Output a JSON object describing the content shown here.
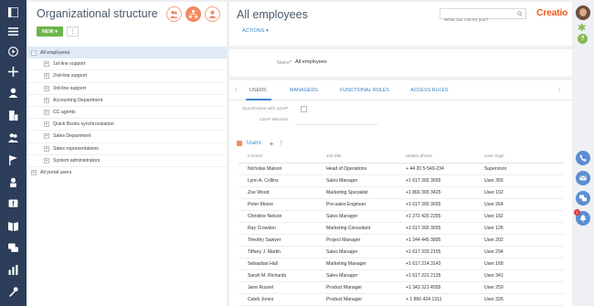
{
  "left_panel": {
    "title": "Organizational structure",
    "new_button": "NEW",
    "dots_button": "⋮",
    "tree": [
      {
        "label": "All employees",
        "toggle": "−",
        "level": 0,
        "selected": true
      },
      {
        "label": "1st-line support",
        "toggle": "+",
        "level": 1
      },
      {
        "label": "2nd-line support",
        "toggle": "+",
        "level": 1
      },
      {
        "label": "3rd-line support",
        "toggle": "+",
        "level": 1
      },
      {
        "label": "Accounting Department",
        "toggle": "+",
        "level": 1
      },
      {
        "label": "CC agents",
        "toggle": "+",
        "level": 1
      },
      {
        "label": "Quick Books synchronization",
        "toggle": "+",
        "level": 1
      },
      {
        "label": "Sales Department",
        "toggle": "+",
        "level": 1
      },
      {
        "label": "Sales representatives",
        "toggle": "+",
        "level": 1
      },
      {
        "label": "System administrators",
        "toggle": "+",
        "level": 1
      },
      {
        "label": "All portal users",
        "toggle": "+",
        "level": 0
      }
    ]
  },
  "main": {
    "title": "All employees",
    "actions_label": "ACTIONS ▾",
    "search_placeholder": "What can I do for you?",
    "logo": "Creatio",
    "name_label": "Name",
    "name_required": "*",
    "name_value": "All employees",
    "tabs": [
      "USERS",
      "MANAGERS",
      "FUNCTIONAL ROLES",
      "ACCESS RULES"
    ],
    "tab_prev": "‹",
    "tab_next": "›",
    "ldap_sync_label": "Synchronize with LDAP",
    "ldap_element_label": "LDAP element",
    "users_header": "Users",
    "users_add": "+",
    "users_menu": "⋮",
    "columns": [
      "Contact",
      "Job title",
      "Mobile phone",
      "User login"
    ],
    "rows": [
      [
        "Nicholas Maison",
        "Head of Operations",
        "+ 44 20 5-549-234",
        "Supervisor"
      ],
      [
        "Lynn A. Collins",
        "Sales Manager",
        "+1 617 365 3655",
        "User 355"
      ],
      [
        "Zoe Wood",
        "Marketing Specialist",
        "+1 866 365 3425",
        "User 102"
      ],
      [
        "Peter Moore",
        "Pre-sales Engineer",
        "+1 617 365 3655",
        "User 264"
      ],
      [
        "Christine Nelson",
        "Sales Manager",
        "+1 272 425 2255",
        "User 182"
      ],
      [
        "Ray  Crowden",
        "Marketing Consultant",
        "+1 617 365 3655",
        "User 126"
      ],
      [
        "Timothy Sawyer",
        "Project Manager",
        "+1 244 445 3895",
        "User 202"
      ],
      [
        "Tiffany J. Martin",
        "Sales Manager",
        "+1 617 333 2155",
        "User 294"
      ],
      [
        "Sebastian Hall",
        "Marketing Manager",
        "+1 617 214 3143",
        "User 168"
      ],
      [
        "Sarah M. Richards",
        "Sales Manager",
        "+1 617 221 2135",
        "User 341"
      ],
      [
        "Jane Russel",
        "Product Manager",
        "+1 343 321 4555",
        "User 259"
      ],
      [
        "Caleb Jones",
        "Product Manager",
        "+ 1 866 424 1311",
        "User 326"
      ]
    ]
  },
  "right_bar": {
    "help_label": "?",
    "gear_label": "✱",
    "notification_count": "1"
  },
  "colors": {
    "nav_bg": "#2c3e5a",
    "accent": "#3d84c6",
    "new_button": "#6fb54a",
    "brand": "#f15b22",
    "orange": "#f58a5e"
  },
  "icons": {
    "nav": [
      "layout-icon",
      "menu-icon",
      "play-icon",
      "add-icon",
      "contact-icon",
      "account-icon",
      "group-icon",
      "flag-icon",
      "person-icon",
      "alert-icon",
      "book-icon",
      "chat-icon",
      "chart-icon",
      "tools-icon"
    ]
  }
}
